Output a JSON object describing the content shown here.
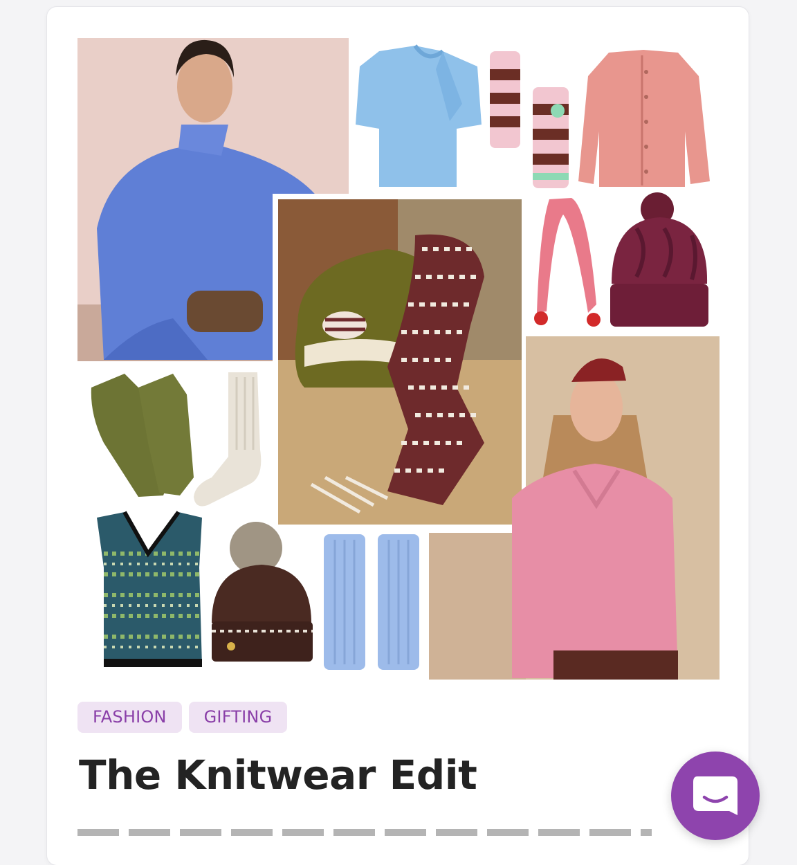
{
  "article": {
    "tags": [
      "FASHION",
      "GIFTING"
    ],
    "title": "The Knitwear Edit"
  },
  "colors": {
    "accent": "#8e44ad",
    "tag_bg": "#efe3f3",
    "tag_text": "#8a3fa8"
  },
  "icons": {
    "chat": "chat-bubble-smile-icon"
  }
}
